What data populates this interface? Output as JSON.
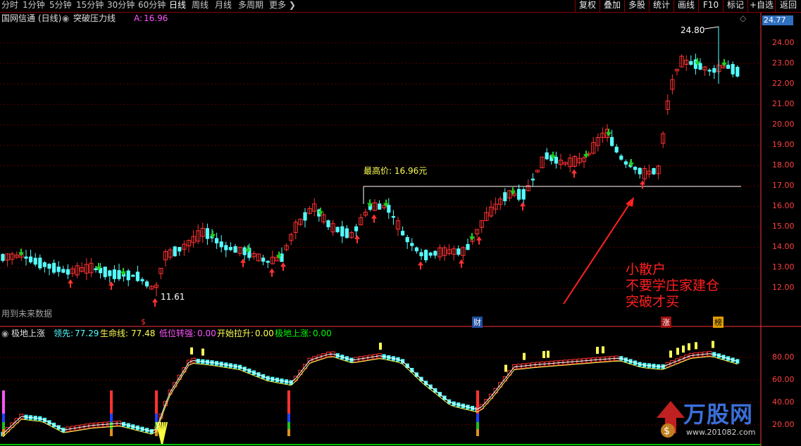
{
  "toolbar": {
    "periods": [
      "分时",
      "1分钟",
      "5分钟",
      "15分钟",
      "30分钟",
      "60分钟",
      "日线",
      "周线",
      "月线",
      "多周期",
      "更多"
    ],
    "active_period": "日线",
    "tools": [
      "复权",
      "叠加",
      "多股",
      "统计",
      "画线",
      "F10",
      "标记",
      "+自选",
      "返回"
    ]
  },
  "stock": {
    "name": "国网信通",
    "period_tag": "(日线)",
    "indicator": "突破压力线",
    "a_label": "A:",
    "a_value": "16.96"
  },
  "main_chart": {
    "price_axis": [
      "24.00",
      "23.00",
      "22.00",
      "21.00",
      "20.00",
      "19.00",
      "18.00",
      "17.00",
      "16.00",
      "15.00",
      "14.00",
      "13.00",
      "12.00"
    ],
    "current_price": "24.77",
    "high_label": "24.80",
    "low_label": "11.61",
    "resistance_label": "最高价: 16.96元",
    "resistance_value": 16.96,
    "future_data_note": "用到未来数据",
    "annotation_lines": [
      "小散户",
      "不要学庄家建仓",
      "突破才买"
    ],
    "event_markers": [
      "$",
      "财",
      "涨",
      "榜"
    ]
  },
  "sub_chart": {
    "title": "极地上涨",
    "leader_label": "领先:",
    "leader_value": "77.29",
    "life_label": "生命线:",
    "life_value": "77.48",
    "low_label": "低位转强:",
    "low_value": "0.00",
    "start_label": "开始拉升:",
    "start_value": "0.00",
    "polar_label": "极地上涨:",
    "polar_value": "0.00",
    "axis": [
      "80.00",
      "60.00",
      "40.00",
      "20.00"
    ]
  },
  "watermark": {
    "text": "万股网",
    "url": "www.201082.com"
  },
  "colors": {
    "up": "#ff3232",
    "down": "#54ffff",
    "axis_red": "#ff3232",
    "yellow": "#ffff54",
    "magenta": "#ff54ff",
    "green": "#00ff00"
  }
}
